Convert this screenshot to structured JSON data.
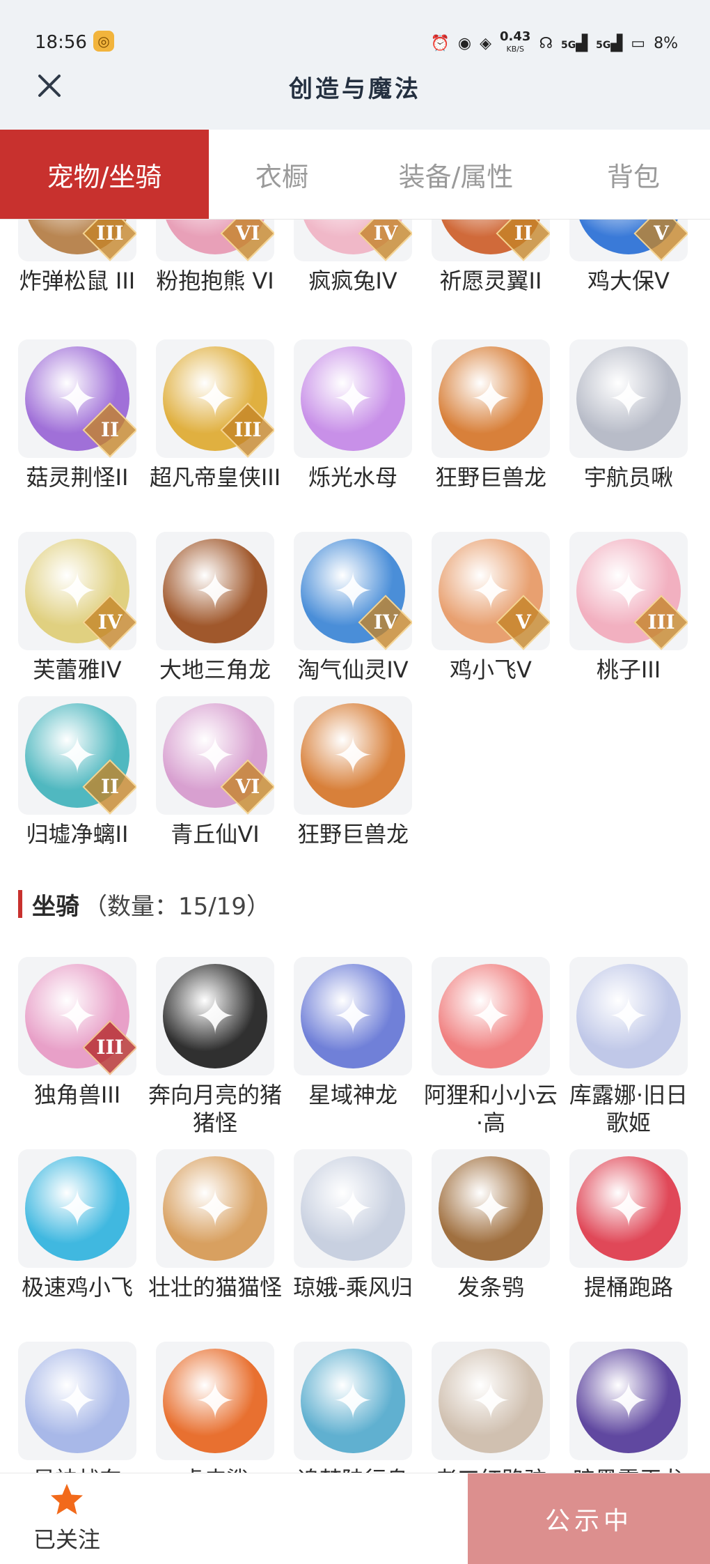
{
  "status_bar": {
    "time": "18:56",
    "net_speed": "0.43",
    "net_unit": "KB/S",
    "signal_1": "5G",
    "signal_2": "5G",
    "battery": "8%"
  },
  "header": {
    "title": "创造与魔法",
    "close_icon": "close-icon"
  },
  "tabs": [
    {
      "label": "宠物/坐骑",
      "active": true
    },
    {
      "label": "衣橱",
      "active": false
    },
    {
      "label": "装备/属性",
      "active": false
    },
    {
      "label": "背包",
      "active": false
    }
  ],
  "pets": [
    {
      "name": "炸弹松鼠 III",
      "tier": "III",
      "color": "#b98652"
    },
    {
      "name": "粉抱抱熊 VI",
      "tier": "VI",
      "color": "#e8a0b8"
    },
    {
      "name": "疯疯兔IV",
      "tier": "IV",
      "color": "#f0b8c8"
    },
    {
      "name": "祈愿灵翼II",
      "tier": "II",
      "color": "#d06a3a"
    },
    {
      "name": "鸡大保V",
      "tier": "V",
      "color": "#3a7ad8"
    },
    {
      "name": "菇灵荆怪II",
      "tier": "II",
      "color": "#a070d8"
    },
    {
      "name": "超凡帝皇侠III",
      "tier": "III",
      "color": "#e0b040"
    },
    {
      "name": "烁光水母",
      "tier": "",
      "color": "#c890e8"
    },
    {
      "name": "狂野巨兽龙",
      "tier": "",
      "color": "#d8803a"
    },
    {
      "name": "宇航员啾",
      "tier": "",
      "color": "#b8bcc8"
    },
    {
      "name": "芙蕾雅IV",
      "tier": "IV",
      "color": "#e0d080"
    },
    {
      "name": "大地三角龙",
      "tier": "",
      "color": "#a0582c"
    },
    {
      "name": "淘气仙灵IV",
      "tier": "IV",
      "color": "#4a8ed8"
    },
    {
      "name": "鸡小飞V",
      "tier": "V",
      "color": "#e8a070"
    },
    {
      "name": "桃子III",
      "tier": "III",
      "color": "#f2b0c0"
    },
    {
      "name": "归墟净螭II",
      "tier": "II",
      "color": "#50b8c0"
    },
    {
      "name": "青丘仙VI",
      "tier": "VI",
      "color": "#d8a0d0"
    },
    {
      "name": "狂野巨兽龙",
      "tier": "",
      "color": "#d8803a"
    }
  ],
  "mounts_section": {
    "label": "坐骑",
    "count": "（数量：15/19）"
  },
  "mounts": [
    {
      "name": "独角兽III",
      "tier": "III",
      "color": "#e8a0c8"
    },
    {
      "name": "奔向月亮的猪猪怪",
      "tier": "",
      "color": "#303030"
    },
    {
      "name": "星域神龙",
      "tier": "",
      "color": "#7080d8"
    },
    {
      "name": "阿狸和小小云·高",
      "tier": "",
      "color": "#f08080"
    },
    {
      "name": "库露娜·旧日歌姬",
      "tier": "",
      "color": "#c0c8e8"
    },
    {
      "name": "极速鸡小飞",
      "tier": "",
      "color": "#40b8e0"
    },
    {
      "name": "壮壮的猫猫怪",
      "tier": "",
      "color": "#d8a060"
    },
    {
      "name": "琼娥-乘风归",
      "tier": "",
      "color": "#c8d0e0"
    },
    {
      "name": "发条鸮",
      "tier": "",
      "color": "#a07040"
    },
    {
      "name": "提桶跑路",
      "tier": "",
      "color": "#e04858"
    },
    {
      "name": "星神战东",
      "tier": "",
      "color": "#a8b8e8"
    },
    {
      "name": "虎皮鲨",
      "tier": "",
      "color": "#e87030"
    },
    {
      "name": "追梦陆行鸟",
      "tier": "",
      "color": "#60b0d0"
    },
    {
      "name": "老工红路驼",
      "tier": "",
      "color": "#d0c0b0"
    },
    {
      "name": "暗黑霸王龙",
      "tier": "",
      "color": "#6048a0"
    }
  ],
  "bottom": {
    "follow_label": "已关注",
    "publish_label": "公示中"
  },
  "colors": {
    "accent": "#c8312e",
    "publish": "#dc8f8e",
    "star": "#f26a1b"
  }
}
